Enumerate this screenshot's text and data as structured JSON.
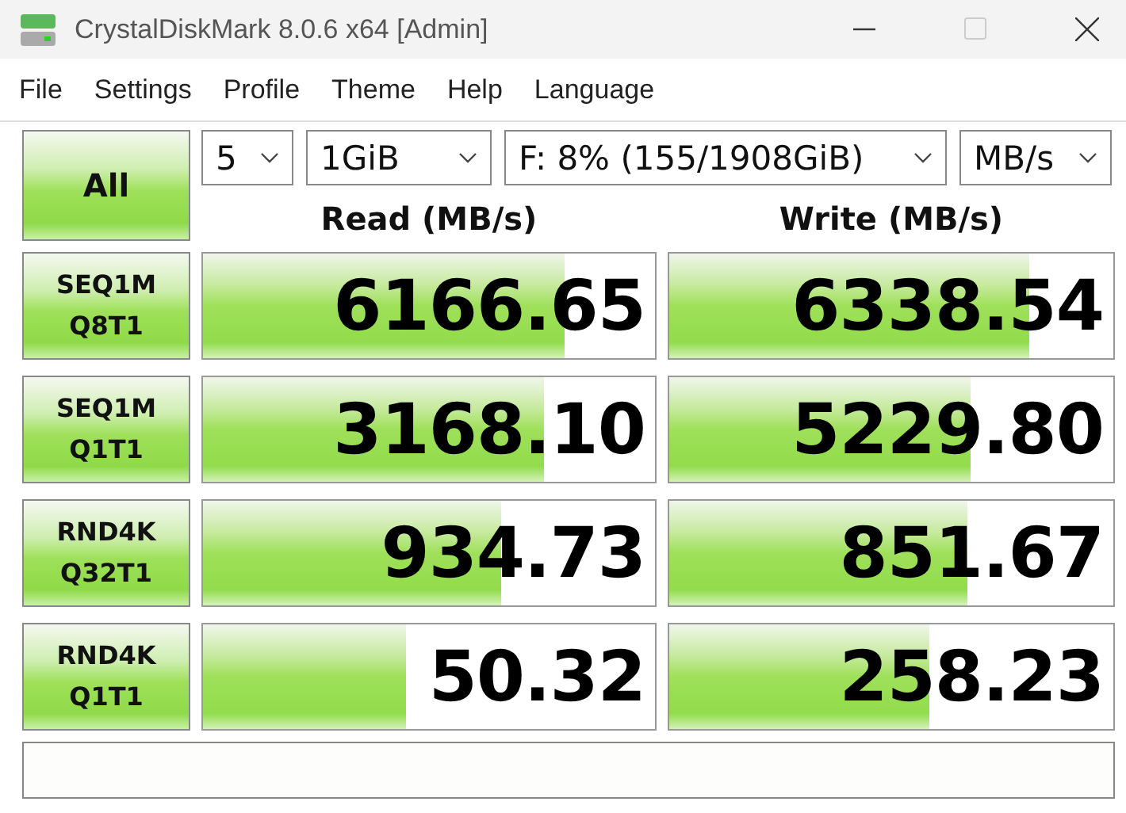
{
  "window": {
    "title": "CrystalDiskMark 8.0.6 x64 [Admin]"
  },
  "menu": [
    "File",
    "Settings",
    "Profile",
    "Theme",
    "Help",
    "Language"
  ],
  "all_button": "All",
  "selectors": [
    {
      "value": "5"
    },
    {
      "value": "1GiB"
    },
    {
      "value": "F: 8% (155/1908GiB)"
    },
    {
      "value": "MB/s"
    }
  ],
  "headers": {
    "read": "Read (MB/s)",
    "write": "Write (MB/s)"
  },
  "tests": [
    {
      "label": [
        "SEQ1M",
        "Q8T1"
      ],
      "read": {
        "value": "6166.65",
        "level": 0.8
      },
      "write": {
        "value": "6338.54",
        "level": 0.81
      }
    },
    {
      "label": [
        "SEQ1M",
        "Q1T1"
      ],
      "read": {
        "value": "3168.10",
        "level": 0.755
      },
      "write": {
        "value": "5229.80",
        "level": 0.68
      }
    },
    {
      "label": [
        "RND4K",
        "Q32T1"
      ],
      "read": {
        "value": "934.73",
        "level": 0.66
      },
      "write": {
        "value": "851.67",
        "level": 0.67
      }
    },
    {
      "label": [
        "RND4K",
        "Q1T1"
      ],
      "read": {
        "value": "50.32",
        "level": 0.45
      },
      "write": {
        "value": "258.23",
        "level": 0.585
      }
    }
  ]
}
